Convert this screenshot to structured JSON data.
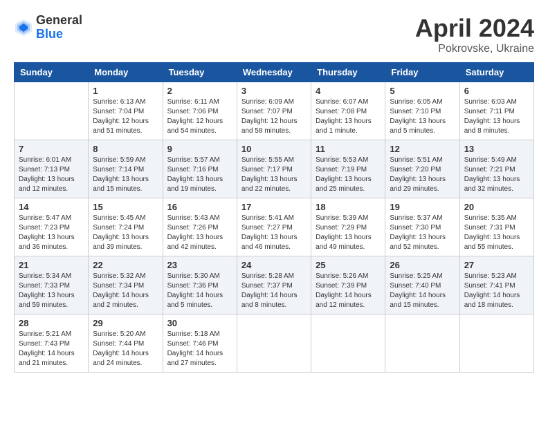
{
  "header": {
    "logo_general": "General",
    "logo_blue": "Blue",
    "month_title": "April 2024",
    "location": "Pokrovske, Ukraine"
  },
  "weekdays": [
    "Sunday",
    "Monday",
    "Tuesday",
    "Wednesday",
    "Thursday",
    "Friday",
    "Saturday"
  ],
  "weeks": [
    [
      {
        "date": "",
        "sunrise": "",
        "sunset": "",
        "daylight": ""
      },
      {
        "date": "1",
        "sunrise": "Sunrise: 6:13 AM",
        "sunset": "Sunset: 7:04 PM",
        "daylight": "Daylight: 12 hours and 51 minutes."
      },
      {
        "date": "2",
        "sunrise": "Sunrise: 6:11 AM",
        "sunset": "Sunset: 7:06 PM",
        "daylight": "Daylight: 12 hours and 54 minutes."
      },
      {
        "date": "3",
        "sunrise": "Sunrise: 6:09 AM",
        "sunset": "Sunset: 7:07 PM",
        "daylight": "Daylight: 12 hours and 58 minutes."
      },
      {
        "date": "4",
        "sunrise": "Sunrise: 6:07 AM",
        "sunset": "Sunset: 7:08 PM",
        "daylight": "Daylight: 13 hours and 1 minute."
      },
      {
        "date": "5",
        "sunrise": "Sunrise: 6:05 AM",
        "sunset": "Sunset: 7:10 PM",
        "daylight": "Daylight: 13 hours and 5 minutes."
      },
      {
        "date": "6",
        "sunrise": "Sunrise: 6:03 AM",
        "sunset": "Sunset: 7:11 PM",
        "daylight": "Daylight: 13 hours and 8 minutes."
      }
    ],
    [
      {
        "date": "7",
        "sunrise": "Sunrise: 6:01 AM",
        "sunset": "Sunset: 7:13 PM",
        "daylight": "Daylight: 13 hours and 12 minutes."
      },
      {
        "date": "8",
        "sunrise": "Sunrise: 5:59 AM",
        "sunset": "Sunset: 7:14 PM",
        "daylight": "Daylight: 13 hours and 15 minutes."
      },
      {
        "date": "9",
        "sunrise": "Sunrise: 5:57 AM",
        "sunset": "Sunset: 7:16 PM",
        "daylight": "Daylight: 13 hours and 19 minutes."
      },
      {
        "date": "10",
        "sunrise": "Sunrise: 5:55 AM",
        "sunset": "Sunset: 7:17 PM",
        "daylight": "Daylight: 13 hours and 22 minutes."
      },
      {
        "date": "11",
        "sunrise": "Sunrise: 5:53 AM",
        "sunset": "Sunset: 7:19 PM",
        "daylight": "Daylight: 13 hours and 25 minutes."
      },
      {
        "date": "12",
        "sunrise": "Sunrise: 5:51 AM",
        "sunset": "Sunset: 7:20 PM",
        "daylight": "Daylight: 13 hours and 29 minutes."
      },
      {
        "date": "13",
        "sunrise": "Sunrise: 5:49 AM",
        "sunset": "Sunset: 7:21 PM",
        "daylight": "Daylight: 13 hours and 32 minutes."
      }
    ],
    [
      {
        "date": "14",
        "sunrise": "Sunrise: 5:47 AM",
        "sunset": "Sunset: 7:23 PM",
        "daylight": "Daylight: 13 hours and 36 minutes."
      },
      {
        "date": "15",
        "sunrise": "Sunrise: 5:45 AM",
        "sunset": "Sunset: 7:24 PM",
        "daylight": "Daylight: 13 hours and 39 minutes."
      },
      {
        "date": "16",
        "sunrise": "Sunrise: 5:43 AM",
        "sunset": "Sunset: 7:26 PM",
        "daylight": "Daylight: 13 hours and 42 minutes."
      },
      {
        "date": "17",
        "sunrise": "Sunrise: 5:41 AM",
        "sunset": "Sunset: 7:27 PM",
        "daylight": "Daylight: 13 hours and 46 minutes."
      },
      {
        "date": "18",
        "sunrise": "Sunrise: 5:39 AM",
        "sunset": "Sunset: 7:29 PM",
        "daylight": "Daylight: 13 hours and 49 minutes."
      },
      {
        "date": "19",
        "sunrise": "Sunrise: 5:37 AM",
        "sunset": "Sunset: 7:30 PM",
        "daylight": "Daylight: 13 hours and 52 minutes."
      },
      {
        "date": "20",
        "sunrise": "Sunrise: 5:35 AM",
        "sunset": "Sunset: 7:31 PM",
        "daylight": "Daylight: 13 hours and 55 minutes."
      }
    ],
    [
      {
        "date": "21",
        "sunrise": "Sunrise: 5:34 AM",
        "sunset": "Sunset: 7:33 PM",
        "daylight": "Daylight: 13 hours and 59 minutes."
      },
      {
        "date": "22",
        "sunrise": "Sunrise: 5:32 AM",
        "sunset": "Sunset: 7:34 PM",
        "daylight": "Daylight: 14 hours and 2 minutes."
      },
      {
        "date": "23",
        "sunrise": "Sunrise: 5:30 AM",
        "sunset": "Sunset: 7:36 PM",
        "daylight": "Daylight: 14 hours and 5 minutes."
      },
      {
        "date": "24",
        "sunrise": "Sunrise: 5:28 AM",
        "sunset": "Sunset: 7:37 PM",
        "daylight": "Daylight: 14 hours and 8 minutes."
      },
      {
        "date": "25",
        "sunrise": "Sunrise: 5:26 AM",
        "sunset": "Sunset: 7:39 PM",
        "daylight": "Daylight: 14 hours and 12 minutes."
      },
      {
        "date": "26",
        "sunrise": "Sunrise: 5:25 AM",
        "sunset": "Sunset: 7:40 PM",
        "daylight": "Daylight: 14 hours and 15 minutes."
      },
      {
        "date": "27",
        "sunrise": "Sunrise: 5:23 AM",
        "sunset": "Sunset: 7:41 PM",
        "daylight": "Daylight: 14 hours and 18 minutes."
      }
    ],
    [
      {
        "date": "28",
        "sunrise": "Sunrise: 5:21 AM",
        "sunset": "Sunset: 7:43 PM",
        "daylight": "Daylight: 14 hours and 21 minutes."
      },
      {
        "date": "29",
        "sunrise": "Sunrise: 5:20 AM",
        "sunset": "Sunset: 7:44 PM",
        "daylight": "Daylight: 14 hours and 24 minutes."
      },
      {
        "date": "30",
        "sunrise": "Sunrise: 5:18 AM",
        "sunset": "Sunset: 7:46 PM",
        "daylight": "Daylight: 14 hours and 27 minutes."
      },
      {
        "date": "",
        "sunrise": "",
        "sunset": "",
        "daylight": ""
      },
      {
        "date": "",
        "sunrise": "",
        "sunset": "",
        "daylight": ""
      },
      {
        "date": "",
        "sunrise": "",
        "sunset": "",
        "daylight": ""
      },
      {
        "date": "",
        "sunrise": "",
        "sunset": "",
        "daylight": ""
      }
    ]
  ]
}
